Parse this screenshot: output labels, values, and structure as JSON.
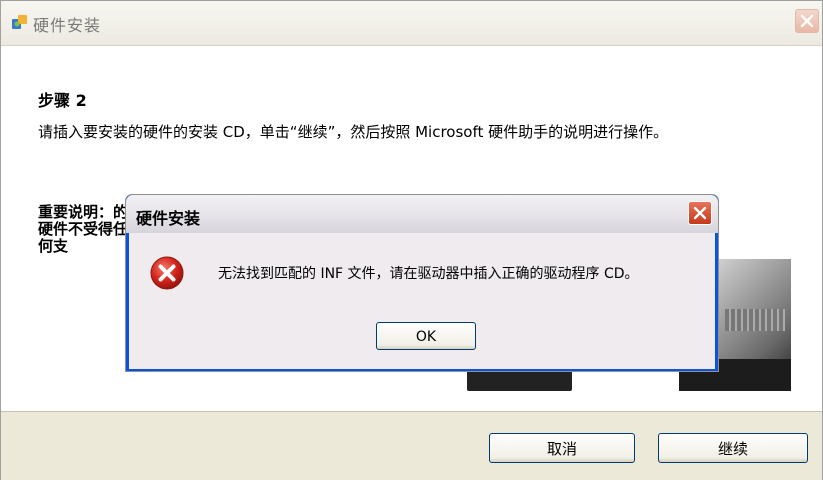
{
  "main_window": {
    "title": "硬件安装",
    "step_title": "步骤 2",
    "instruction": "请插入要安装的硬件的安装 CD，单击“继续”，然后按照 Microsoft 硬件助手的说明进行操作。",
    "important_partial": "重要说明：的硬件不受得任何支",
    "buttons": {
      "cancel": "取消",
      "continue": "继续"
    }
  },
  "dialog": {
    "title": "硬件安装",
    "message": "无法找到匹配的 INF 文件，请在驱动器中插入正确的驱动程序 CD。",
    "ok_label": "OK",
    "icon": "error-icon"
  },
  "colors": {
    "error_red": "#d4251c",
    "button_border": "#003c74",
    "xp_face": "#ece9d8"
  }
}
